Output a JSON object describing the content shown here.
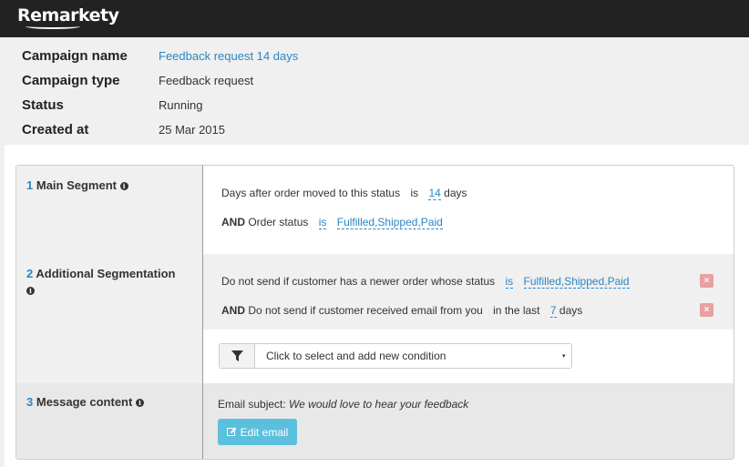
{
  "header": {
    "logo_text": "Remarkety"
  },
  "campaign": {
    "fields": [
      {
        "label": "Campaign name",
        "value": "Feedback request 14 days"
      },
      {
        "label": "Campaign type",
        "value": "Feedback request"
      },
      {
        "label": "Status",
        "value": "Running"
      },
      {
        "label": "Created at",
        "value": "25 Mar 2015"
      }
    ]
  },
  "sections": {
    "main_segment": {
      "number": "1",
      "title": "Main Segment",
      "line1": {
        "text": "Days after order moved to this status",
        "op": "is",
        "value": "14",
        "unit": "days"
      },
      "line2": {
        "conj": "AND",
        "text": "Order status",
        "op": "is",
        "value": "Fulfilled,Shipped,Paid"
      }
    },
    "additional": {
      "number": "2",
      "title": "Additional Segmentation",
      "line1": {
        "text": "Do not send if customer has a newer order whose status",
        "op": "is",
        "value": "Fulfilled,Shipped,Paid"
      },
      "line2": {
        "conj": "AND",
        "text": "Do not send if customer received email from you",
        "op": "in the last",
        "value": "7",
        "unit": "days"
      },
      "remove_symbol": "×",
      "select": {
        "placeholder": "Click to select and add new condition"
      }
    },
    "message": {
      "number": "3",
      "title": "Message content",
      "subject_label": "Email subject:",
      "subject_value": "We would love to hear your feedback",
      "edit_label": "Edit email"
    }
  },
  "icons": {
    "info": "info-icon",
    "filter": "filter-icon",
    "edit": "edit-icon",
    "remove": "remove-icon",
    "caret": "caret-icon"
  },
  "colors": {
    "link": "#2a86c4",
    "button": "#5bc0de",
    "remove": "#e8a0a0",
    "topbar": "#222222"
  }
}
